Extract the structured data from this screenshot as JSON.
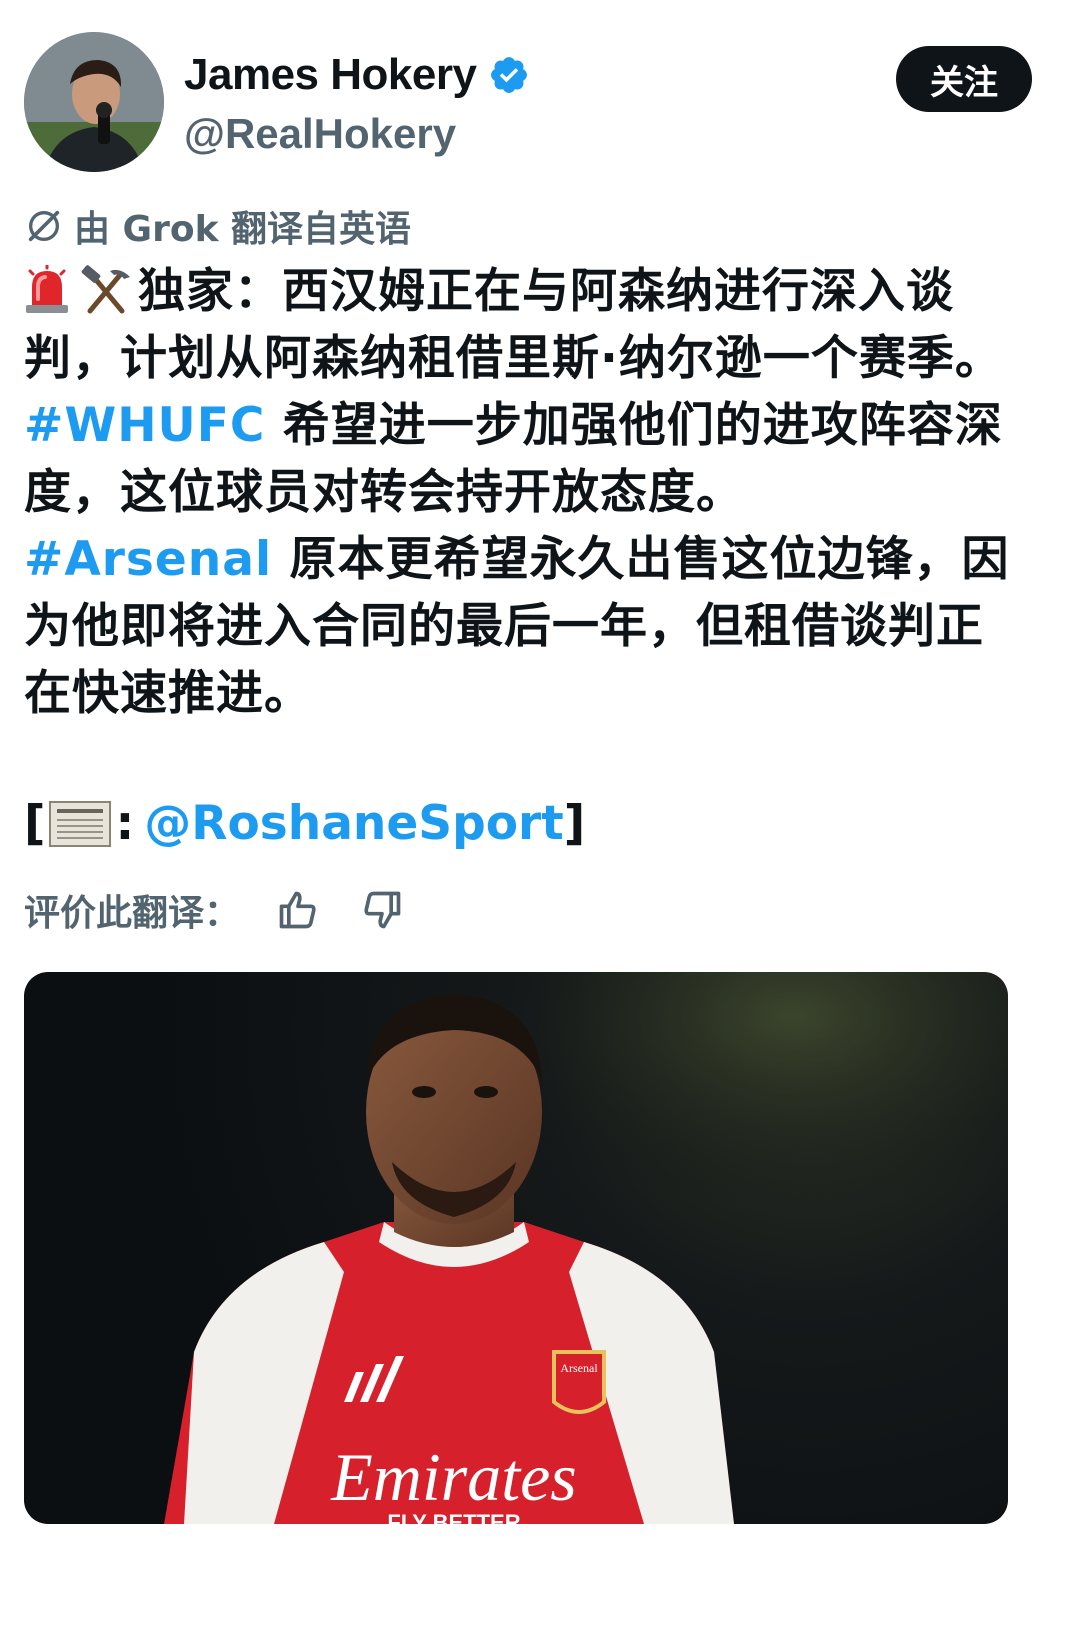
{
  "author": {
    "display_name": "James Hokery",
    "handle": "@RealHokery",
    "verified": true
  },
  "follow_button": {
    "label": "关注"
  },
  "translation": {
    "note": "由 Grok 翻译自英语"
  },
  "tweet": {
    "segment_1": "独家：西汉姆正在与阿森纳进行深入谈判，计划从阿森纳租借里斯·纳尔逊一个赛季。",
    "hashtag_1": "#WHUFC",
    "segment_2": " 希望进一步加强他们的进攻阵容深度，这位球员对转会持开放态度。",
    "hashtag_2": "#Arsenal",
    "segment_3": " 原本更希望永久出售这位边锋，因为他即将进入合同的最后一年，但租借谈判正在快速推进。",
    "source_open": "[",
    "source_colon": ":",
    "source_mention": "@RoshaneSport",
    "source_close": "]"
  },
  "rating": {
    "label": "评价此翻译："
  },
  "media": {
    "jersey_sponsor": "Emirates",
    "badge_text": "Arsenal",
    "sponsor_sub": "FLY BETTER"
  },
  "colors": {
    "accent": "#1d9bf0",
    "text": "#0f1419",
    "muted": "#536471"
  }
}
